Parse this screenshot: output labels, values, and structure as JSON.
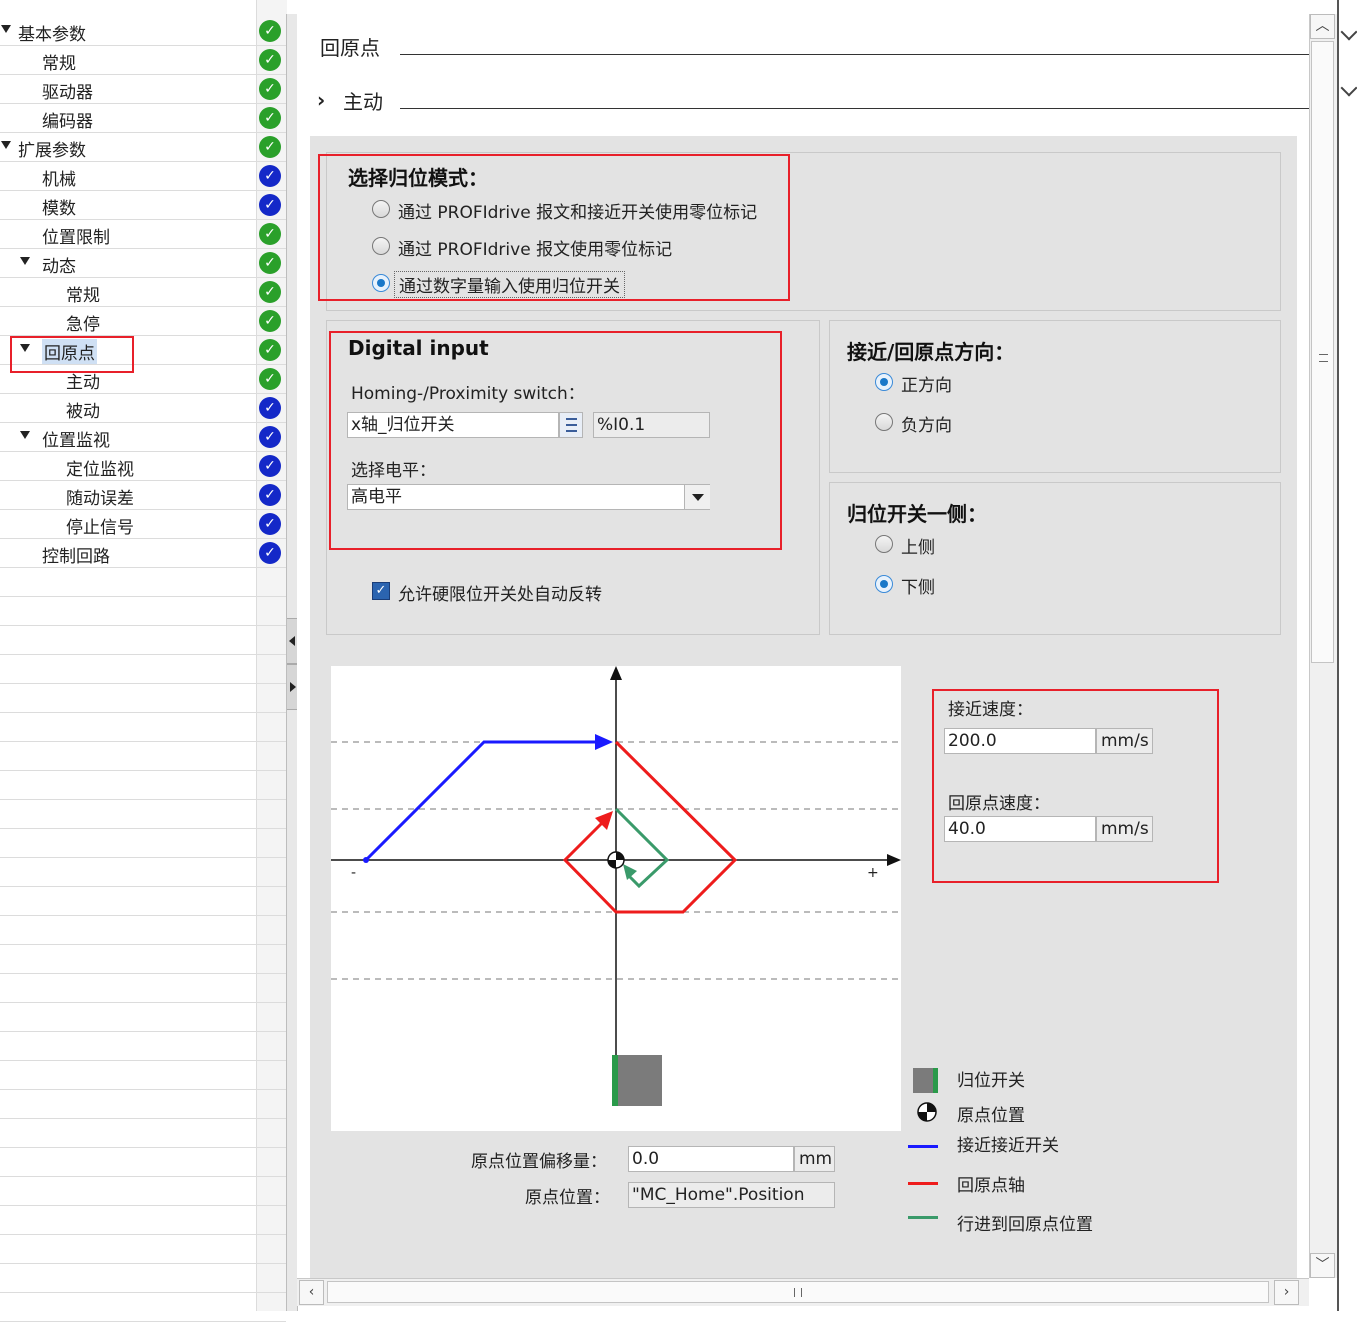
{
  "tree": {
    "items": [
      {
        "label": "基本参数",
        "level": 0,
        "expanded": true,
        "status": "ok"
      },
      {
        "label": "常规",
        "level": 1,
        "status": "ok"
      },
      {
        "label": "驱动器",
        "level": 1,
        "status": "ok"
      },
      {
        "label": "编码器",
        "level": 1,
        "status": "ok"
      },
      {
        "label": "扩展参数",
        "level": 0,
        "expanded": true,
        "status": "ok"
      },
      {
        "label": "机械",
        "level": 1,
        "status": "todo"
      },
      {
        "label": "模数",
        "level": 1,
        "status": "todo"
      },
      {
        "label": "位置限制",
        "level": 1,
        "status": "ok"
      },
      {
        "label": "动态",
        "level": 1,
        "expanded": true,
        "status": "ok"
      },
      {
        "label": "常规",
        "level": 2,
        "status": "ok"
      },
      {
        "label": "急停",
        "level": 2,
        "status": "ok"
      },
      {
        "label": "回原点",
        "level": 1,
        "expanded": true,
        "selected": true,
        "status": "ok"
      },
      {
        "label": "主动",
        "level": 2,
        "status": "ok"
      },
      {
        "label": "被动",
        "level": 2,
        "status": "todo"
      },
      {
        "label": "位置监视",
        "level": 1,
        "expanded": true,
        "status": "todo"
      },
      {
        "label": "定位监视",
        "level": 2,
        "status": "todo"
      },
      {
        "label": "随动误差",
        "level": 2,
        "status": "todo"
      },
      {
        "label": "停止信号",
        "level": 2,
        "status": "todo"
      },
      {
        "label": "控制回路",
        "level": 1,
        "status": "todo"
      }
    ]
  },
  "header": {
    "section_title": "回原点",
    "subsection_title": "主动",
    "subsection_chevron": "›"
  },
  "mode_group": {
    "title": "选择归位模式：",
    "options": [
      {
        "label": "通过 PROFIdrive 报文和接近开关使用零位标记",
        "selected": false
      },
      {
        "label": "通过 PROFIdrive 报文使用零位标记",
        "selected": false
      },
      {
        "label": "通过数字量输入使用归位开关",
        "selected": true
      }
    ]
  },
  "digital_input": {
    "title": "Digital input",
    "switch_label": "Homing-/Proximity switch：",
    "switch_value": "x轴_归位开关",
    "switch_address": "%I0.1",
    "level_label": "选择电平：",
    "level_value": "高电平",
    "auto_reverse_label": "允许硬限位开关处自动反转",
    "auto_reverse_checked": true
  },
  "direction_group": {
    "title": "接近/回原点方向：",
    "options": [
      {
        "label": "正方向",
        "selected": true
      },
      {
        "label": "负方向",
        "selected": false
      }
    ]
  },
  "side_group": {
    "title": "归位开关一侧：",
    "options": [
      {
        "label": "上侧",
        "selected": false
      },
      {
        "label": "下侧",
        "selected": true
      }
    ]
  },
  "speeds": {
    "approach_label": "接近速度：",
    "approach_value": "200.0",
    "approach_unit": "mm/s",
    "homing_label": "回原点速度：",
    "homing_value": "40.0",
    "homing_unit": "mm/s"
  },
  "offset": {
    "offset_label": "原点位置偏移量：",
    "offset_value": "0.0",
    "offset_unit": "mm",
    "position_label": "原点位置：",
    "position_value": "\"MC_Home\".Position"
  },
  "diagram": {
    "minus_label": "-",
    "plus_label": "+"
  },
  "legend": {
    "switch": "归位开关",
    "origin": "原点位置",
    "approach": "接近接近开关",
    "homing": "回原点轴",
    "travel": "行进到回原点位置"
  },
  "colors": {
    "ok": "#2aa02a",
    "todo": "#1428c8",
    "highlight": "#e8202a",
    "approach_line": "#1a1aff",
    "homing_line": "#ee1c1c",
    "travel_line": "#3a9a6a"
  }
}
